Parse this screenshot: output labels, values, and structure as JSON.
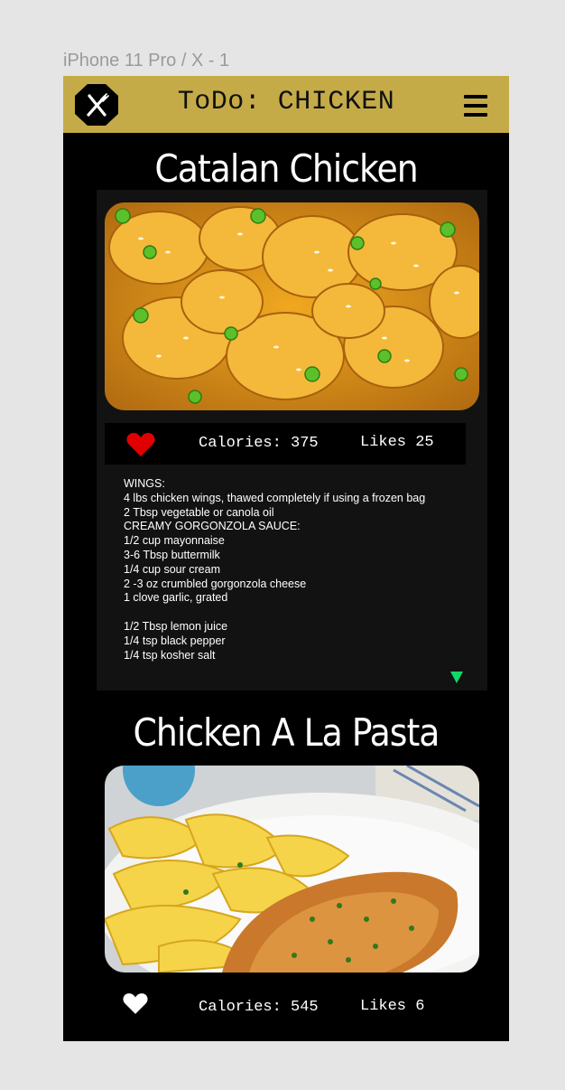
{
  "frame_label": "iPhone 11 Pro / X - 1",
  "header": {
    "title": "ToDo: CHICKEN",
    "logo_icon": "fork-knife-icon",
    "menu_icon": "hamburger-menu-icon",
    "bar_color": "#c5ab48"
  },
  "recipes": [
    {
      "title": "Catalan Chicken",
      "liked": true,
      "heart_color": "#e00000",
      "calories_text": "Calories: 375",
      "likes_text": "Likes 25",
      "ingredients": [
        "WINGS:",
        "4 lbs chicken wings, thawed completely if using a frozen bag",
        "2 Tbsp vegetable or canola oil",
        "CREAMY GORGONZOLA SAUCE:",
        "1/2 cup mayonnaise",
        "3-6 Tbsp buttermilk",
        "1/4 cup sour cream",
        "2 -3 oz crumbled gorgonzola cheese",
        "1 clove garlic, grated",
        "",
        "1/2 Tbsp lemon juice",
        "1/4 tsp black pepper",
        "1/4 tsp kosher salt"
      ],
      "expand_icon": "triangle-down-icon",
      "expand_color": "#12d86a"
    },
    {
      "title": "Chicken A La Pasta",
      "liked": false,
      "heart_color": "#ffffff",
      "calories_text": "Calories: 545",
      "likes_text": "Likes 6"
    }
  ]
}
